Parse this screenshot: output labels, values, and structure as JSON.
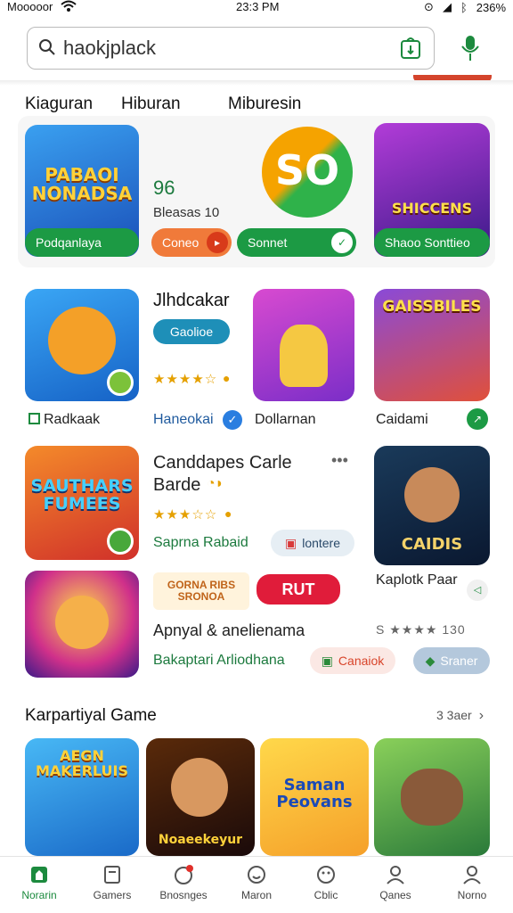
{
  "status_bar": {
    "carrier": "Mooooor",
    "time": "23:3 PM",
    "battery": "236%"
  },
  "search": {
    "value": "haokjplack"
  },
  "categories": [
    "Kiaguran",
    "Hiburan",
    "Miburesin"
  ],
  "featured": {
    "tile1": {
      "art": "PABAOI NONADSA",
      "action": "Podqanlaya"
    },
    "promo": {
      "value": "96",
      "sub": "Bleasas 10",
      "logo": "SO",
      "btn1": "Coneo",
      "btn2": "Sonnet"
    },
    "tile3": {
      "art": "SHICCENS",
      "action": "Shaoo Sonttieo"
    }
  },
  "row2": {
    "left_label": "Radkaak",
    "title": "Jlhdcakar",
    "badge": "Gaolioe",
    "stars": "★★★★☆",
    "mid_label": "Haneokai",
    "right_art_label": "Dollarnan",
    "right_tile_art": "GAISSBILES",
    "right_label": "Caidami"
  },
  "row3": {
    "tile_art": "SAUTHARS FUMEES",
    "title_1": "Canddapes Carle",
    "title_2": "Barde",
    "stars": "★★★☆☆",
    "sub": "Saprna Rabaid",
    "chip": "lontere",
    "right_art": "CAIDIS",
    "more": "•••"
  },
  "row4": {
    "promo_small": "GORNA RIBS SRONOA",
    "rut": "RUT",
    "title": "Apnyal & anelienama",
    "sub": "Bakaptari Arliodhana",
    "chip1": "Canaiok",
    "right_title": "Kaplotk Paar",
    "right_stars": "S ★★★★ 130",
    "chip2": "Sraner"
  },
  "section": {
    "title": "Karpartiyal Game",
    "see_all": "3 3aer"
  },
  "bottom_tiles": [
    "AEGN MAKERLUIS",
    "Noaeekeyur",
    "Saman Peovans",
    ""
  ],
  "nav": [
    "Norarin",
    "Gamers",
    "Bnosnges",
    "Maron",
    "Cblic",
    "Qanes",
    "Norno"
  ],
  "colors": {
    "accent_green": "#1c8a3e",
    "accent_orange": "#e8542a"
  }
}
